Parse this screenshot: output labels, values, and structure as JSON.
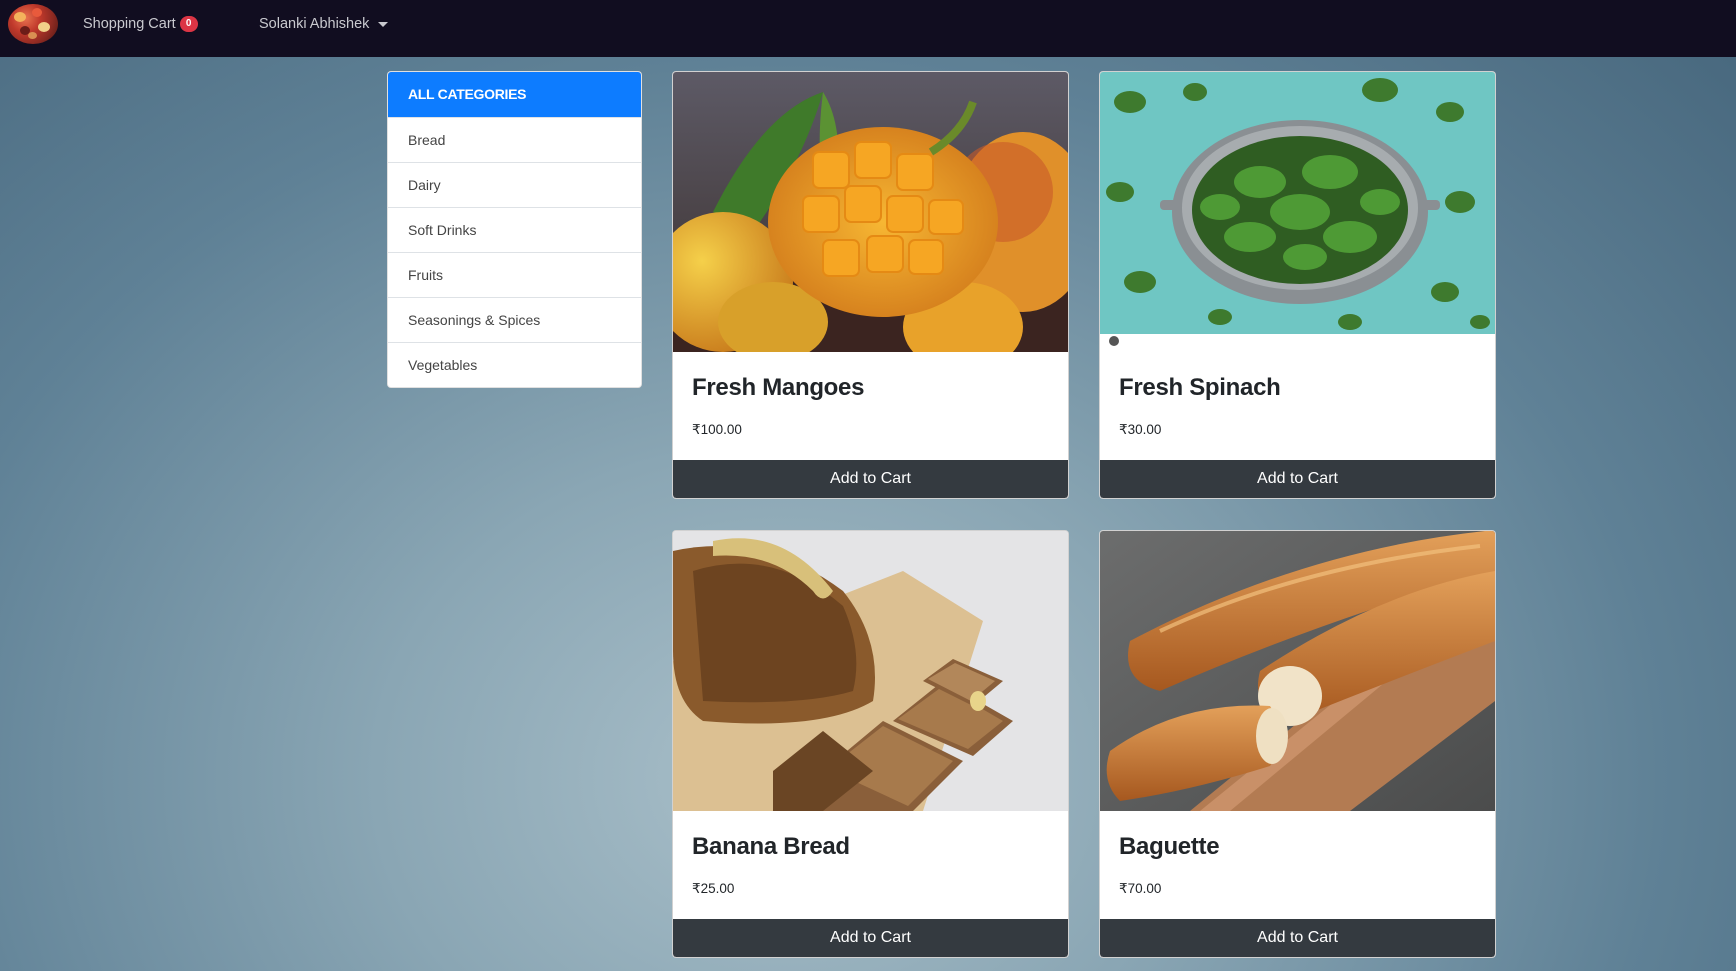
{
  "navbar": {
    "logo_icon": "food-logo",
    "cart_label": "Shopping Cart",
    "cart_count": "0",
    "user_name": "Solanki Abhishek"
  },
  "categories": {
    "header": "ALL CATEGORIES",
    "items": [
      "Bread",
      "Dairy",
      "Soft Drinks",
      "Fruits",
      "Seasonings & Spices",
      "Vegetables"
    ]
  },
  "products": [
    {
      "name": "Fresh Mangoes",
      "price": "₹100.00",
      "button": "Add to Cart",
      "image": "mango-image"
    },
    {
      "name": "Fresh Spinach",
      "price": "₹30.00",
      "button": "Add to Cart",
      "image": "spinach-image"
    },
    {
      "name": "Banana Bread",
      "price": "₹25.00",
      "button": "Add to Cart",
      "image": "banana-bread-image"
    },
    {
      "name": "Baguette",
      "price": "₹70.00",
      "button": "Add to Cart",
      "image": "baguette-image"
    }
  ],
  "colors": {
    "navbar": "#110d20",
    "category_header": "#0d7cff",
    "button": "#343a40",
    "badge": "#dc3545"
  }
}
